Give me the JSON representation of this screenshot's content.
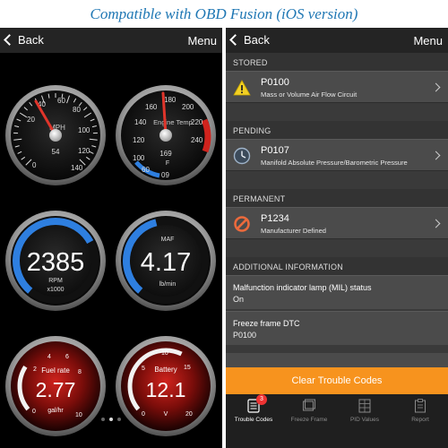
{
  "banner": "Compatible with OBD Fusion (iOS version)",
  "left_screen": {
    "nav": {
      "back": "Back",
      "menu": "Menu"
    },
    "gauges": [
      {
        "label": "MPH",
        "value": "54",
        "ticks": [
          "20",
          "40",
          "60",
          "80",
          "100",
          "120",
          "140",
          "0"
        ]
      },
      {
        "label": "Engine Temp",
        "unit": "F",
        "value": "169",
        "ticks": [
          "120",
          "140",
          "160",
          "180",
          "200",
          "220",
          "240",
          "60",
          "09",
          "100"
        ]
      },
      {
        "value": "2385",
        "label": "RPM",
        "unit": "x1000",
        "fill": 0.72
      },
      {
        "label": "MAF",
        "value": "4.17",
        "unit": "lb/min",
        "fill": 0.45
      },
      {
        "label": "Fuel rate",
        "value": "2.77",
        "unit": "gal/hr",
        "ticks": [
          "2",
          "4",
          "6",
          "8",
          "10",
          "0"
        ],
        "fill": 0.28
      },
      {
        "label": "Battery",
        "value": "12.1",
        "unit": "V",
        "ticks": [
          "5",
          "10",
          "15",
          "20",
          "0"
        ],
        "fill": 0.6
      }
    ],
    "page_dots": 3,
    "active_dot": 1
  },
  "right_screen": {
    "nav": {
      "back": "Back",
      "menu": "Menu"
    },
    "sections": {
      "stored": "STORED",
      "pending": "PENDING",
      "permanent": "PERMANENT",
      "additional": "ADDITIONAL INFORMATION"
    },
    "codes": {
      "stored": {
        "code": "P0100",
        "desc": "Mass or Volume Air Flow Circuit",
        "icon": "warning-icon"
      },
      "pending": {
        "code": "P0107",
        "desc": "Manifold Absolute Pressure/Barometric Pressure",
        "icon": "clock-icon"
      },
      "permanent": {
        "code": "P1234",
        "desc": "Manufacturer Defined",
        "icon": "prohibited-icon"
      }
    },
    "info": [
      {
        "label": "Malfunction indicator lamp (MIL) status",
        "value": "On"
      },
      {
        "label": "Freeze frame DTC",
        "value": "P0100"
      }
    ],
    "clear_button": "Clear Trouble Codes",
    "tabs": [
      {
        "label": "Trouble Codes",
        "icon": "trouble-codes-icon",
        "badge": "3"
      },
      {
        "label": "Freeze Frame",
        "icon": "freeze-frame-icon"
      },
      {
        "label": "PID Values",
        "icon": "pid-values-icon"
      },
      {
        "label": "Report",
        "icon": "report-icon"
      }
    ]
  },
  "colors": {
    "accent_blue": "#2e7fe0",
    "orange": "#f7931e",
    "needle_red": "#e0352b"
  }
}
